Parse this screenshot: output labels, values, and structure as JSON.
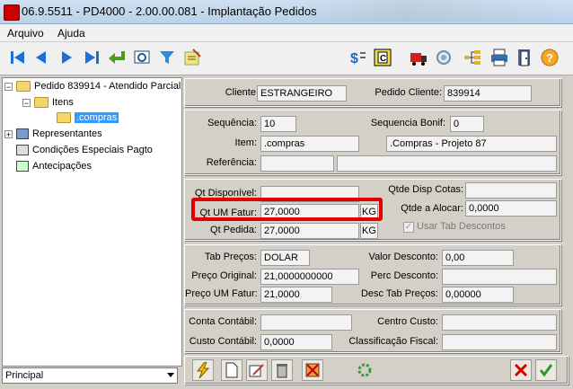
{
  "window": {
    "title": "06.9.5511 - PD4000 - 2.00.00.081 - Implantação Pedidos"
  },
  "menu": {
    "items": [
      "Arquivo",
      "Ajuda"
    ]
  },
  "toolbar": {
    "icons": [
      "first-record-icon",
      "previous-record-icon",
      "next-record-icon",
      "last-record-icon",
      "return-icon",
      "preview-icon",
      "filter-icon",
      "edit-note-icon",
      "price-icon",
      "copy-icon",
      "truck-icon",
      "search-icon",
      "tree-icon",
      "print-icon",
      "exit-icon",
      "help-icon"
    ]
  },
  "tree": {
    "order": "Pedido 839914 - Atendido Parcial",
    "itens": "Itens",
    "compras": ".compras",
    "representantes": "Representantes",
    "condicoes": "Condições Especiais Pagto",
    "antecipacoes": "Antecipações"
  },
  "view_select": {
    "value": "Principal"
  },
  "header": {
    "cliente_label": "Cliente:",
    "cliente": "ESTRANGEIRO",
    "pedido_cliente_label": "Pedido Cliente:",
    "pedido_cliente": "839914"
  },
  "item": {
    "sequencia_label": "Sequência:",
    "sequencia": "10",
    "seq_bonif_label": "Sequencia Bonif:",
    "seq_bonif": "0",
    "item_label": "Item:",
    "item_code": ".compras",
    "item_desc": ".Compras - Projeto 87",
    "referencia_label": "Referência:",
    "referencia_a": "",
    "referencia_b": ""
  },
  "qty": {
    "qt_disponivel_label": "Qt Disponível:",
    "qt_disponivel": "",
    "qtde_disp_cotas_label": "Qtde Disp Cotas:",
    "qtde_disp_cotas": "",
    "qt_um_fatur_label": "Qt UM Fatur:",
    "qt_um_fatur": "27,0000",
    "qt_um_fatur_unit": "KG",
    "qtde_alocar_label": "Qtde a Alocar:",
    "qtde_alocar": "0,0000",
    "qt_pedida_label": "Qt Pedida:",
    "qt_pedida": "27,0000",
    "qt_pedida_unit": "KG",
    "usar_tab_descontos_label": "Usar Tab Descontos",
    "usar_tab_descontos_checked": true
  },
  "price": {
    "tab_precos_label": "Tab Preços:",
    "tab_precos": "DOLAR",
    "valor_desconto_label": "Valor Desconto:",
    "valor_desconto": "0,00",
    "preco_original_label": "Preço Original:",
    "preco_original": "21,0000000000",
    "perc_desconto_label": "Perc Desconto:",
    "perc_desconto": "",
    "preco_um_fatur_label": "Preço UM Fatur:",
    "preco_um_fatur": "21,0000",
    "desc_tab_precos_label": "Desc Tab Preços:",
    "desc_tab_precos": "0,00000"
  },
  "accounting": {
    "conta_contabil_label": "Conta Contábil:",
    "conta_contabil": "",
    "centro_custo_label": "Centro Custo:",
    "centro_custo": "",
    "custo_contabil_label": "Custo Contábil:",
    "custo_contabil": "0,0000",
    "classificacao_fiscal_label": "Classificação Fiscal:",
    "classificacao_fiscal": ""
  },
  "colors": {
    "highlight": "#e00000",
    "selection": "#3399ff"
  }
}
